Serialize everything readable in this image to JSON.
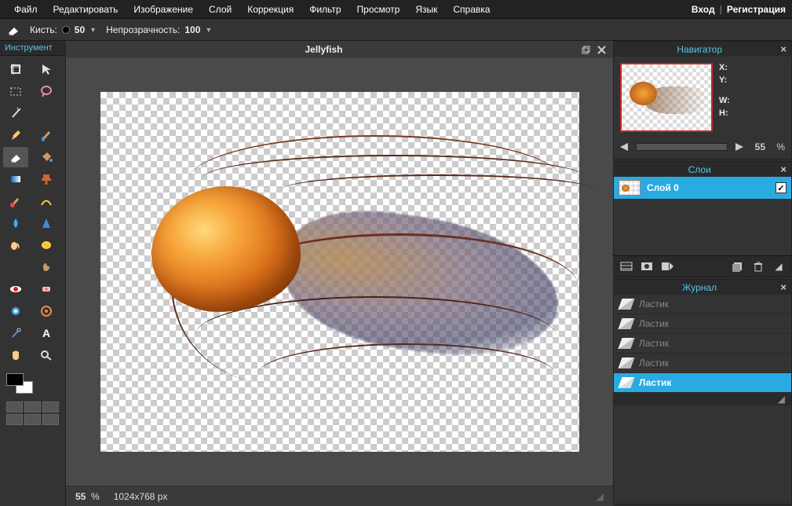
{
  "menu": {
    "items": [
      "Файл",
      "Редактировать",
      "Изображение",
      "Слой",
      "Коррекция",
      "Фильтр",
      "Просмотр",
      "Язык",
      "Справка"
    ],
    "login": "Вход",
    "register": "Регистрация"
  },
  "options": {
    "brush_label": "Кисть:",
    "brush_value": "50",
    "opacity_label": "Непрозрачность:",
    "opacity_value": "100"
  },
  "tools": {
    "title": "Инструмент",
    "items": [
      {
        "name": "crop-tool"
      },
      {
        "name": "move-tool"
      },
      {
        "name": "marquee-tool"
      },
      {
        "name": "lasso-tool"
      },
      {
        "name": "wand-tool"
      },
      {
        "name": ""
      },
      {
        "name": "pencil-tool"
      },
      {
        "name": "brush-tool"
      },
      {
        "name": "eraser-tool",
        "selected": true
      },
      {
        "name": "paint-bucket-tool"
      },
      {
        "name": "gradient-tool"
      },
      {
        "name": "clone-stamp-tool"
      },
      {
        "name": "color-replace-tool"
      },
      {
        "name": "draw-tool"
      },
      {
        "name": "blur-tool"
      },
      {
        "name": "sharpen-tool"
      },
      {
        "name": "smudge-tool"
      },
      {
        "name": "sponge-tool"
      },
      {
        "name": "dodge-tool"
      },
      {
        "name": "burn-tool"
      },
      {
        "name": "redeye-tool"
      },
      {
        "name": "spot-heal-tool"
      },
      {
        "name": "bloat-tool"
      },
      {
        "name": "pinch-tool"
      },
      {
        "name": "colorpicker-tool"
      },
      {
        "name": "type-tool"
      },
      {
        "name": "hand-tool"
      },
      {
        "name": "zoom-tool"
      }
    ]
  },
  "document": {
    "title": "Jellyfish"
  },
  "status": {
    "zoom": "55",
    "percent": "%",
    "dims": "1024x768 px"
  },
  "navigator": {
    "title": "Навигатор",
    "x_label": "X:",
    "y_label": "Y:",
    "w_label": "W:",
    "h_label": "H:",
    "zoom": "55",
    "percent": "%"
  },
  "layers": {
    "title": "Слои",
    "items": [
      {
        "name": "Слой 0",
        "visible": true
      }
    ]
  },
  "history": {
    "title": "Журнал",
    "items": [
      {
        "label": "Ластик",
        "dim": true
      },
      {
        "label": "Ластик",
        "dim": true
      },
      {
        "label": "Ластик",
        "dim": true
      },
      {
        "label": "Ластик",
        "dim": true
      },
      {
        "label": "Ластик",
        "active": true
      }
    ]
  }
}
